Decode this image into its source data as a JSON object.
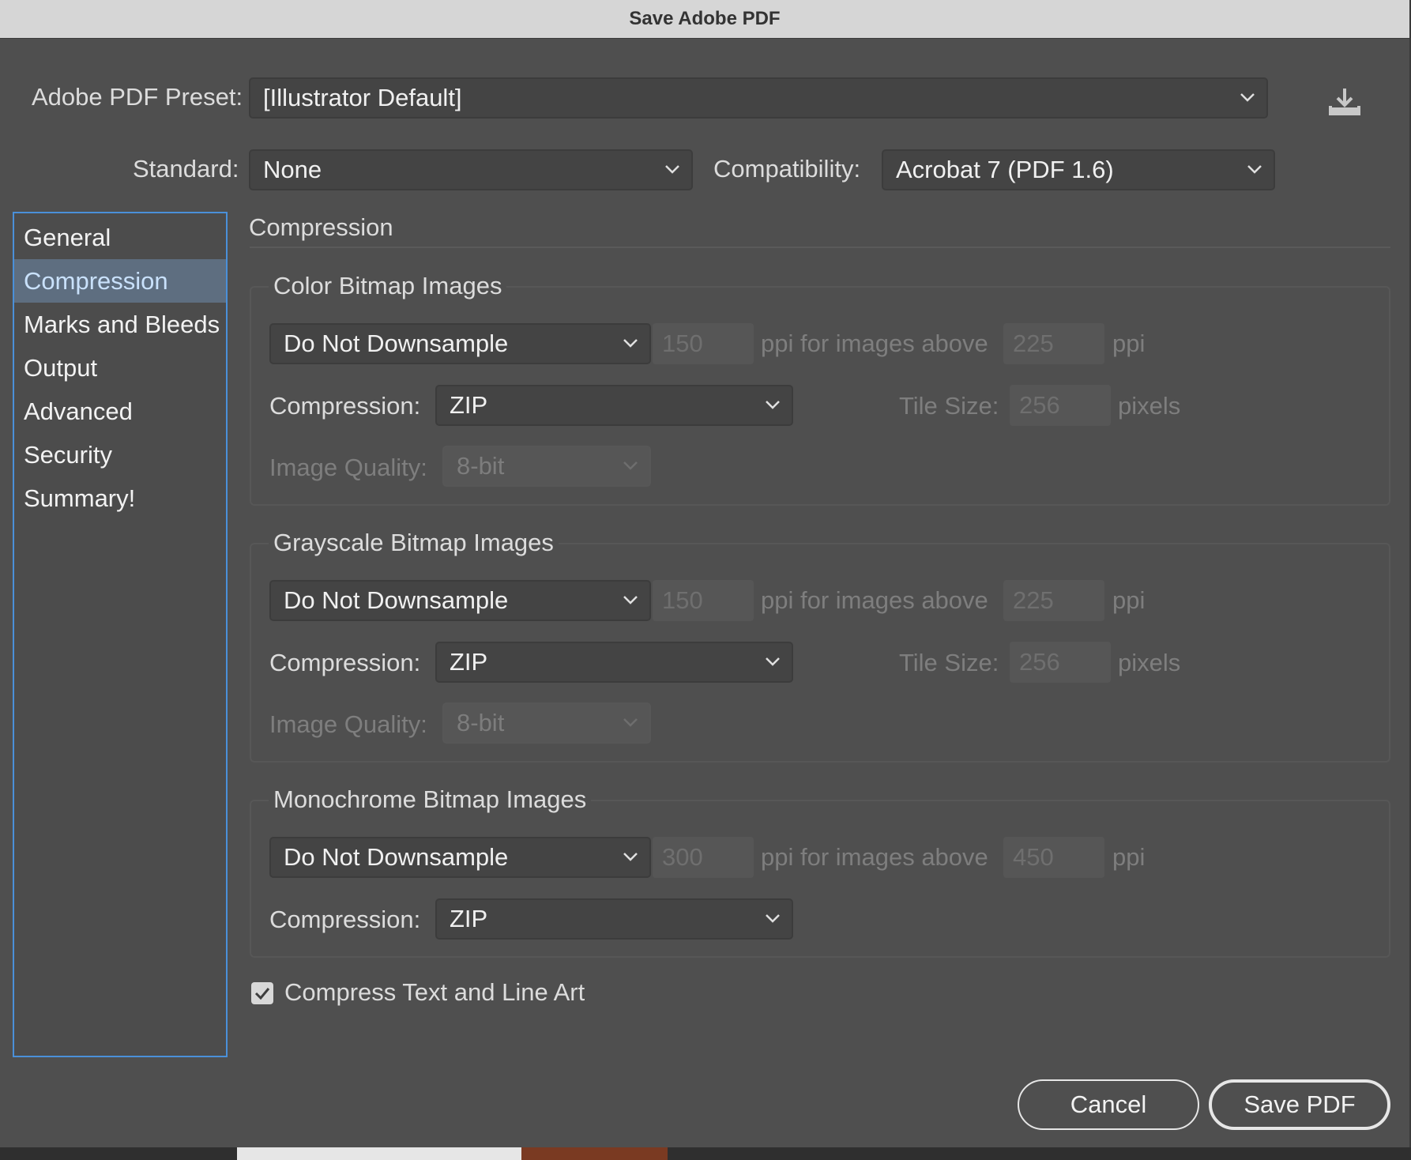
{
  "window": {
    "title": "Save Adobe PDF"
  },
  "preset": {
    "label": "Adobe PDF Preset:",
    "value": "[Illustrator Default]",
    "save_icon": "save-preset-icon"
  },
  "standard": {
    "label": "Standard:",
    "value": "None"
  },
  "compatibility": {
    "label": "Compatibility:",
    "value": "Acrobat 7 (PDF 1.6)"
  },
  "sidebar": {
    "items": [
      {
        "label": "General",
        "active": false
      },
      {
        "label": "Compression",
        "active": true
      },
      {
        "label": "Marks and Bleeds",
        "active": false
      },
      {
        "label": "Output",
        "active": false
      },
      {
        "label": "Advanced",
        "active": false
      },
      {
        "label": "Security",
        "active": false
      },
      {
        "label": "Summary!",
        "active": false
      }
    ]
  },
  "section": {
    "title": "Compression"
  },
  "color": {
    "title": "Color Bitmap Images",
    "downsample": "Do Not Downsample",
    "ppi": "150",
    "ppi_text": "ppi for images above",
    "above": "225",
    "ppi_unit": "ppi",
    "compression_label": "Compression:",
    "compression": "ZIP",
    "tile_label": "Tile Size:",
    "tile": "256",
    "tile_unit": "pixels",
    "quality_label": "Image Quality:",
    "quality": "8-bit"
  },
  "grayscale": {
    "title": "Grayscale Bitmap Images",
    "downsample": "Do Not Downsample",
    "ppi": "150",
    "ppi_text": "ppi for images above",
    "above": "225",
    "ppi_unit": "ppi",
    "compression_label": "Compression:",
    "compression": "ZIP",
    "tile_label": "Tile Size:",
    "tile": "256",
    "tile_unit": "pixels",
    "quality_label": "Image Quality:",
    "quality": "8-bit"
  },
  "mono": {
    "title": "Monochrome Bitmap Images",
    "downsample": "Do Not Downsample",
    "ppi": "300",
    "ppi_text": "ppi for images above",
    "above": "450",
    "ppi_unit": "ppi",
    "compression_label": "Compression:",
    "compression": "ZIP"
  },
  "compress_text": {
    "label": "Compress Text and Line Art",
    "checked": true
  },
  "buttons": {
    "cancel": "Cancel",
    "save": "Save PDF"
  },
  "colors": {
    "accent": "#4a90d9",
    "selection": "#5e6e80",
    "dialog": "#4f4f4f"
  }
}
